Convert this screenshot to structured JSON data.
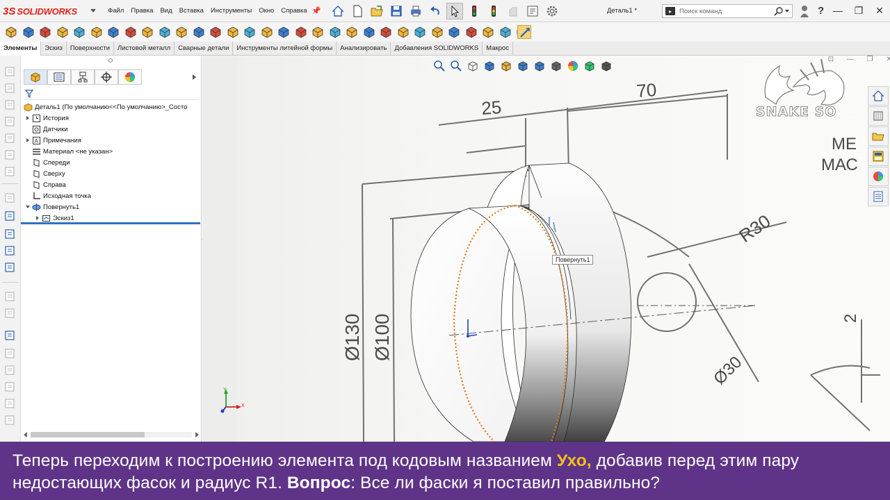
{
  "app": {
    "brand": "SOLIDWORKS",
    "brand_prefix": "3S",
    "doc_title": "Деталь1 *"
  },
  "menu": [
    "Файл",
    "Правка",
    "Вид",
    "Вставка",
    "Инструменты",
    "Окно",
    "Справка"
  ],
  "search": {
    "placeholder": "Поиск команд"
  },
  "help_label": "?",
  "window_controls": [
    "—",
    "❐",
    "✕"
  ],
  "tabs": [
    {
      "label": "Элементы",
      "active": true
    },
    {
      "label": "Эскиз"
    },
    {
      "label": "Поверхности"
    },
    {
      "label": "Листовой металл"
    },
    {
      "label": "Сварные детали"
    },
    {
      "label": "Инструменты литейной формы"
    },
    {
      "label": "Анализировать"
    },
    {
      "label": "Добавления SOLIDWORKS"
    },
    {
      "label": "Макрос"
    }
  ],
  "tree": {
    "root": "Деталь1  (По умолчанию<<По умолчанию>_Состо",
    "items": [
      {
        "label": "История",
        "icon": "history-icon",
        "expand": "closed",
        "indent": 1
      },
      {
        "label": "Датчики",
        "icon": "sensors-icon",
        "expand": "none",
        "indent": 1
      },
      {
        "label": "Примечания",
        "icon": "annotations-icon",
        "expand": "closed",
        "indent": 1
      },
      {
        "label": "Материал <не указан>",
        "icon": "material-icon",
        "expand": "none",
        "indent": 1
      },
      {
        "label": "Спереди",
        "icon": "plane-icon",
        "expand": "none",
        "indent": 1
      },
      {
        "label": "Сверху",
        "icon": "plane-icon",
        "expand": "none",
        "indent": 1
      },
      {
        "label": "Справа",
        "icon": "plane-icon",
        "expand": "none",
        "indent": 1
      },
      {
        "label": "Исходная точка",
        "icon": "origin-icon",
        "expand": "none",
        "indent": 1
      },
      {
        "label": "Повернуть1",
        "icon": "revolve-feature-icon",
        "expand": "open",
        "indent": 1
      },
      {
        "label": "Эскиз1",
        "icon": "sketch-icon",
        "expand": "closed",
        "indent": 2
      }
    ]
  },
  "viewport": {
    "tooltip": "Повернуть1",
    "watermark": "SNAKE SO",
    "drawing_labels": {
      "dim_25": "25",
      "dim_70": "70",
      "dim_r30": "R30",
      "dim_d130": "Ø130",
      "dim_d100": "Ø100",
      "dim_d30": "Ø30",
      "dim_2": "2",
      "note_line1": "МЕ",
      "note_line2": "МАС"
    },
    "triad": {
      "y": "Y",
      "x": "X"
    }
  },
  "caption": {
    "part1": "Теперь переходим к построению элемента под кодовым названием ",
    "highlight": "Ухо,",
    "part2": " добавив перед этим пару недостающих фасок и радиус R1. ",
    "bold": "Вопрос",
    "part3": ": Все ли фаски я поставил правильно?"
  },
  "colors": {
    "brand_red": "#e2231a",
    "caption_bg": "#5f3488",
    "caption_highlight": "#f2c21b",
    "selection_orange": "#e07a14",
    "rollback_blue": "#2f74c0"
  }
}
